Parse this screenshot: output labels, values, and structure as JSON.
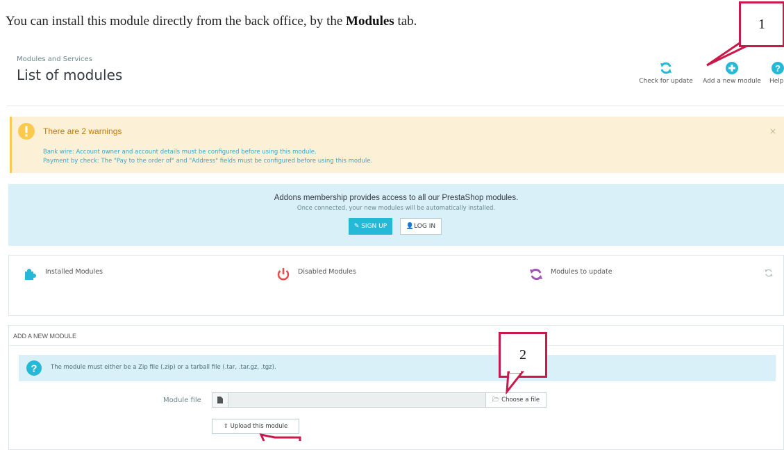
{
  "intro": {
    "before": "You can install this module directly from the back office, by the ",
    "strong": "Modules",
    "after": " tab."
  },
  "callouts": {
    "one": "1",
    "two": "2"
  },
  "header": {
    "breadcrumb": "Modules and Services",
    "title": "List of modules",
    "toolbar": [
      {
        "label": "Check for update",
        "icon": "refresh-icon"
      },
      {
        "label": "Add a new module",
        "icon": "plus-circle-icon"
      },
      {
        "label": "Help",
        "icon": "question-circle-icon"
      }
    ]
  },
  "warnings": {
    "title": "There are 2 warnings",
    "lines": [
      "Bank wire: Account owner and account details must be configured before using this module.",
      "Payment by check: The \"Pay to the order of\" and \"Address\" fields must be configured before using this module."
    ],
    "close": "×"
  },
  "addons": {
    "title": "Addons membership provides access to all our PrestaShop modules.",
    "subtitle": "Once connected, your new modules will be automatically installed.",
    "signup": "SIGN UP",
    "login": "LOG IN"
  },
  "stats": [
    {
      "label": "Installed Modules",
      "icon": "puzzle-icon"
    },
    {
      "label": "Disabled Modules",
      "icon": "power-icon"
    },
    {
      "label": "Modules to update",
      "icon": "refresh-icon"
    }
  ],
  "add_module": {
    "heading": "ADD A NEW MODULE",
    "info": "The module must either be a Zip file (.zip) or a tarball file (.tar, .tar.gz, .tgz).",
    "field_label": "Module file",
    "choose": "Choose a file",
    "upload": "Upload this module"
  },
  "colors": {
    "accent": "#25b9d7",
    "warning_bg": "#fcf1d6",
    "warning_icon": "#fcc94f",
    "callout_border": "#c8194a",
    "disabled_red": "#e84e4e",
    "update_purple": "#a354b6"
  }
}
